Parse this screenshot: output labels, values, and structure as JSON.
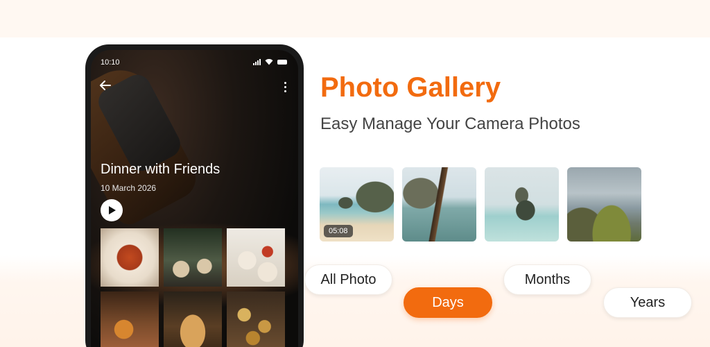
{
  "colors": {
    "accent": "#f26b0f",
    "subtitle": "#444444"
  },
  "phone": {
    "status_time": "10:10",
    "status_icons": [
      "signal-icon",
      "wifi-icon",
      "battery-icon"
    ],
    "album": {
      "title": "Dinner with Friends",
      "date": "10 March 2026"
    }
  },
  "promo": {
    "title": "Photo Gallery",
    "subtitle": "Easy Manage Your Camera Photos"
  },
  "thumbnails": [
    {
      "duration": "05:08"
    },
    {},
    {},
    {}
  ],
  "filters": [
    {
      "label": "All Photo",
      "active": false
    },
    {
      "label": "Days",
      "active": true
    },
    {
      "label": "Months",
      "active": false
    },
    {
      "label": "Years",
      "active": false
    }
  ]
}
